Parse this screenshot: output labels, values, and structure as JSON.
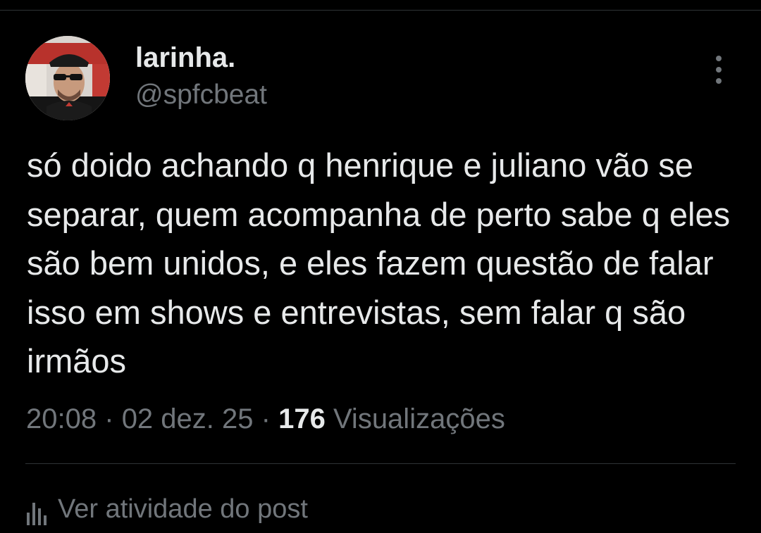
{
  "tweet": {
    "author": {
      "display_name": "larinha.",
      "handle": "@spfcbeat"
    },
    "text": "só doido achando q henrique e juliano vão se separar, quem acompanha de perto sabe q eles são bem unidos, e eles fazem questão de falar isso em shows e entrevistas, sem falar q são irmãos",
    "time": "20:08",
    "separator": "·",
    "date": "02 dez. 25",
    "views_count": "176",
    "views_label": "Visualizações",
    "activity_label": "Ver atividade do post"
  },
  "icons": {
    "more": "more-vertical-icon",
    "activity": "bar-chart-icon"
  },
  "colors": {
    "background": "#000000",
    "primary_text": "#e7e9ea",
    "secondary_text": "#71767b",
    "divider": "#2f3336"
  }
}
